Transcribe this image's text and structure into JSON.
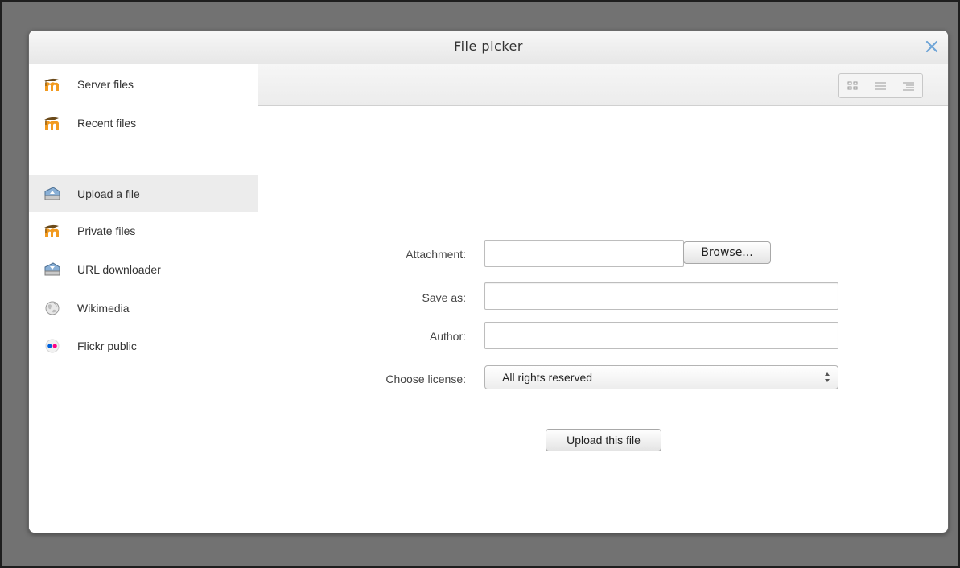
{
  "dialog": {
    "title": "File picker"
  },
  "sidebar": {
    "items": [
      {
        "label": "Server files",
        "icon": "moodle-icon"
      },
      {
        "label": "Recent files",
        "icon": "moodle-icon"
      },
      {
        "label": "Upload a file",
        "icon": "upload-icon",
        "active": true
      },
      {
        "label": "Private files",
        "icon": "moodle-icon"
      },
      {
        "label": "URL downloader",
        "icon": "download-icon"
      },
      {
        "label": "Wikimedia",
        "icon": "wikimedia-icon"
      },
      {
        "label": "Flickr public",
        "icon": "flickr-icon"
      }
    ]
  },
  "toolbar": {
    "view_modes": [
      "icons-view-icon",
      "list-view-icon",
      "tree-view-icon"
    ]
  },
  "form": {
    "attachment_label": "Attachment:",
    "attachment_value": "",
    "browse_label": "Browse...",
    "save_as_label": "Save as:",
    "save_as_value": "",
    "author_label": "Author:",
    "author_value": "",
    "license_label": "Choose license:",
    "license_value": "All rights reserved",
    "upload_label": "Upload this file"
  },
  "colors": {
    "backdrop": "#727272",
    "titlebar": "#ececec",
    "active_item": "#ececec",
    "close_icon": "#6fa5d7",
    "moodle_orange": "#f29a1f",
    "flickr_blue": "#0063dc",
    "flickr_pink": "#ff0084"
  }
}
